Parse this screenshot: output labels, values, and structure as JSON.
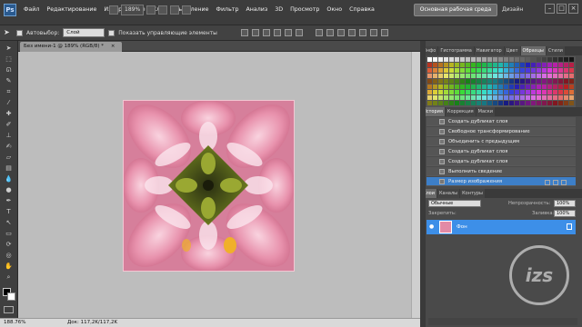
{
  "menubar": {
    "logo": "Ps",
    "items": [
      "Файл",
      "Редактирование",
      "Изображение",
      "Слои",
      "Выделение",
      "Фильтр",
      "Анализ",
      "3D",
      "Просмотр",
      "Окно",
      "Справка"
    ],
    "zoom": "189%",
    "workspace_button": "Основная рабочая среда",
    "workspace_design": "Дизайн"
  },
  "options": {
    "autoselect_label": "Автовыбор:",
    "autoselect_value": "Слой",
    "show_controls_label": "Показать управляющие элементы"
  },
  "document": {
    "tab_title": "Без имени-1 @ 189% (RGB/8) *"
  },
  "status": {
    "zoom": "188.76%",
    "doc_info": "Док: 117,2K/117,2K"
  },
  "panels": {
    "top_tabs": [
      "Инфо",
      "Гистограмма",
      "Навигатор",
      "Цвет",
      "Образцы",
      "Стили"
    ],
    "top_active": "Образцы",
    "history_tabs": [
      "История",
      "Коррекция",
      "Маски"
    ],
    "history_items": [
      {
        "label": "Создать дубликат слоя",
        "selected": false
      },
      {
        "label": "Свободное трансформирование",
        "selected": false
      },
      {
        "label": "Объединить с предыдущим",
        "selected": false
      },
      {
        "label": "Создать дубликат слоя",
        "selected": false
      },
      {
        "label": "Создать дубликат слоя",
        "selected": false
      },
      {
        "label": "Выполнить сведение",
        "selected": false
      },
      {
        "label": "Размер изображения",
        "selected": true
      }
    ],
    "layer_tabs": [
      "Слои",
      "Каналы",
      "Контуры"
    ],
    "blend_mode": "Обычные",
    "opacity_label": "Непрозрачность:",
    "opacity_value": "100%",
    "lock_label": "Закрепить:",
    "fill_label": "Заливка:",
    "fill_value": "100%",
    "layer_name": "Фон"
  },
  "watermark": "izs",
  "colors": {
    "selection_blue": "#3d8fe8",
    "workspace_gray": "#bdbdbd"
  }
}
